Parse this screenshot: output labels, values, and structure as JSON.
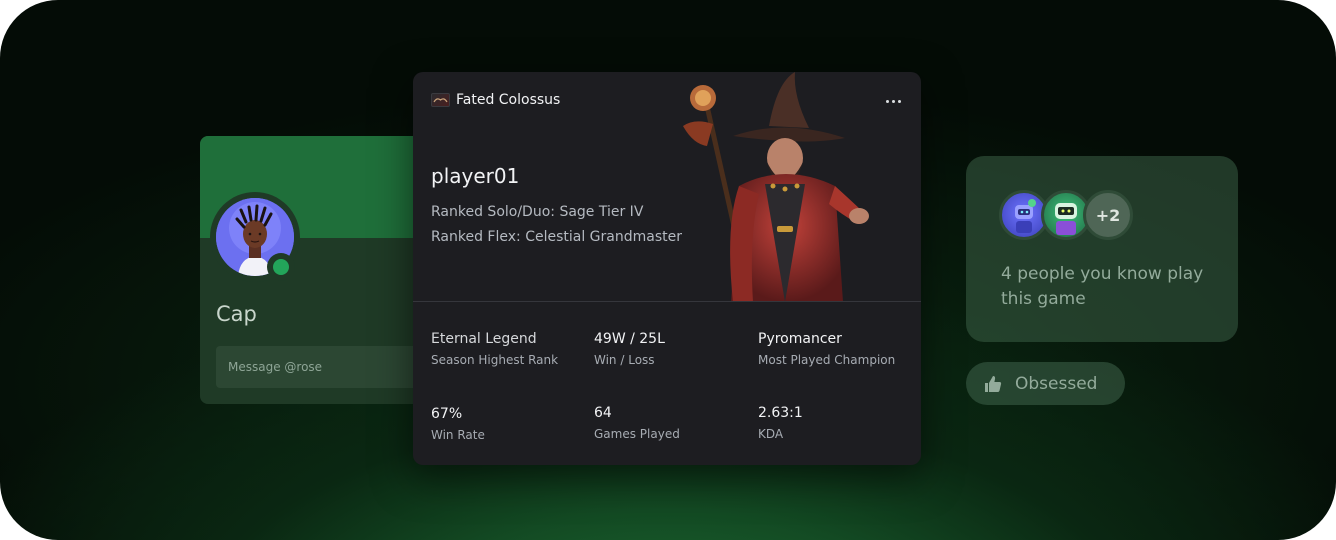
{
  "profile": {
    "name": "Cap",
    "message_placeholder": "Message @rose",
    "status": "online"
  },
  "game_card": {
    "game_title": "Fated Colossus",
    "player_name": "player01",
    "rank_solo": "Ranked Solo/Duo: Sage Tier IV",
    "rank_flex": "Ranked Flex: Celestial Grandmaster",
    "stats": [
      {
        "value": "Eternal Legend",
        "label": "Season Highest Rank"
      },
      {
        "value": "49W / 25L",
        "label": "Win / Loss"
      },
      {
        "value": "Pyromancer",
        "label": "Most Played Champion"
      },
      {
        "value": "67%",
        "label": "Win Rate"
      },
      {
        "value": "64",
        "label": "Games Played"
      },
      {
        "value": "2.63:1",
        "label": "KDA"
      }
    ]
  },
  "social": {
    "extra_count": "+2",
    "text": "4 people you know play this game"
  },
  "reaction": {
    "label": "Obsessed",
    "icon": "thumbs-up-icon"
  },
  "colors": {
    "accent_green": "#23a55a",
    "card_bg": "#1d1d21",
    "banner_green": "#1f6f3a"
  }
}
